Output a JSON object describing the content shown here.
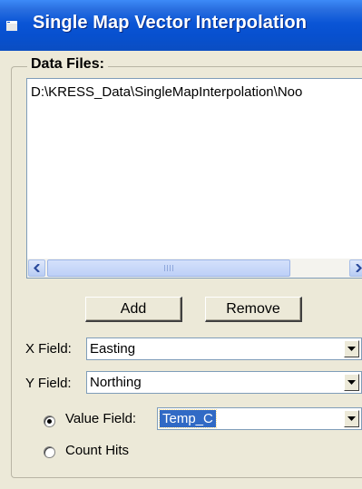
{
  "window": {
    "title": "Single Map Vector Interpolation"
  },
  "data_files": {
    "legend": "Data Files:",
    "items": [
      "D:\\KRESS_Data\\SingleMapInterpolation\\Noo"
    ],
    "scrollbar_grip": "III"
  },
  "buttons": {
    "add": "Add",
    "remove": "Remove"
  },
  "x_field": {
    "label": "X Field:",
    "value": "Easting"
  },
  "y_field": {
    "label": "Y Field:",
    "value": "Northing"
  },
  "value_field": {
    "label": "Value Field:",
    "value": "Temp_C",
    "checked": true
  },
  "count_hits": {
    "label": "Count Hits",
    "checked": false
  },
  "colors": {
    "titlebar": "#0a55d6",
    "window_bg": "#ece9d8",
    "selection": "#316ac5"
  }
}
